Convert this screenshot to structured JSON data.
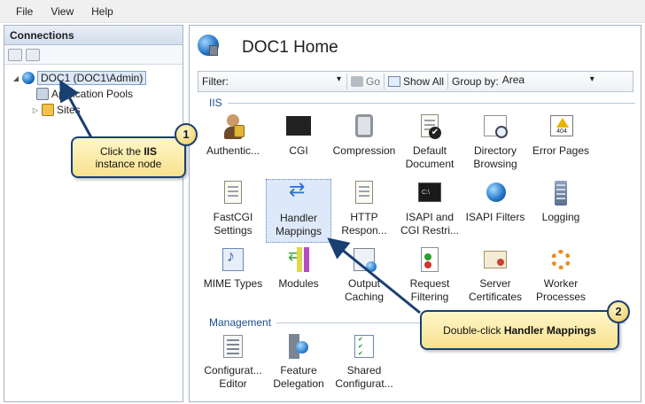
{
  "menu": {
    "items": [
      "File",
      "View",
      "Help"
    ]
  },
  "connections": {
    "title": "Connections",
    "tree": [
      {
        "label": "DOC1 (DOC1\\Admin)",
        "selected": true
      },
      {
        "label": "Application Pools"
      },
      {
        "label": "Sites"
      }
    ]
  },
  "main": {
    "title": "DOC1 Home",
    "filter": {
      "label": "Filter:",
      "value": "",
      "go_label": "Go",
      "show_all_label": "Show All",
      "group_by_label": "Group by:",
      "group_by_value": "Area"
    },
    "sections": {
      "iis": "IIS",
      "management": "Management"
    },
    "iis_items": [
      {
        "label": "Authentic...",
        "icon": "authentication-icon"
      },
      {
        "label": "CGI",
        "icon": "cgi-icon"
      },
      {
        "label": "Compression",
        "icon": "compression-icon"
      },
      {
        "label": "Default\nDocument",
        "icon": "default-document-icon"
      },
      {
        "label": "Directory\nBrowsing",
        "icon": "directory-browsing-icon"
      },
      {
        "label": "Error Pages",
        "icon": "error-pages-icon"
      },
      {
        "label": "FastCGI\nSettings",
        "icon": "fastcgi-icon"
      },
      {
        "label": "Handler\nMappings",
        "icon": "handler-mappings-icon",
        "selected": true
      },
      {
        "label": "HTTP\nRespon...",
        "icon": "http-response-icon"
      },
      {
        "label": "ISAPI and\nCGI Restri...",
        "icon": "isapi-cgi-restrictions-icon"
      },
      {
        "label": "ISAPI Filters",
        "icon": "isapi-filters-icon"
      },
      {
        "label": "Logging",
        "icon": "logging-icon"
      },
      {
        "label": "MIME Types",
        "icon": "mime-types-icon"
      },
      {
        "label": "Modules",
        "icon": "modules-icon"
      },
      {
        "label": "Output\nCaching",
        "icon": "output-caching-icon"
      },
      {
        "label": "Request\nFiltering",
        "icon": "request-filtering-icon"
      },
      {
        "label": "Server\nCertificates",
        "icon": "server-certificates-icon"
      },
      {
        "label": "Worker\nProcesses",
        "icon": "worker-processes-icon"
      }
    ],
    "management_items": [
      {
        "label": "Configurat...\nEditor",
        "icon": "configuration-editor-icon"
      },
      {
        "label": "Feature\nDelegation",
        "icon": "feature-delegation-icon"
      },
      {
        "label": "Shared\nConfigurat...",
        "icon": "shared-configuration-icon"
      }
    ]
  },
  "callouts": [
    {
      "number": "1",
      "text_before": "Click the ",
      "text_bold": "IIS",
      "text_after": "instance node"
    },
    {
      "number": "2",
      "text_before": "Double-click ",
      "text_bold": "Handler Mappings",
      "text_after": ""
    }
  ],
  "colors": {
    "section_heading": "#1d4e8c",
    "callout_border": "#1a3f73",
    "callout_fill": "#f8e28e",
    "selection": "#dde9f8"
  }
}
